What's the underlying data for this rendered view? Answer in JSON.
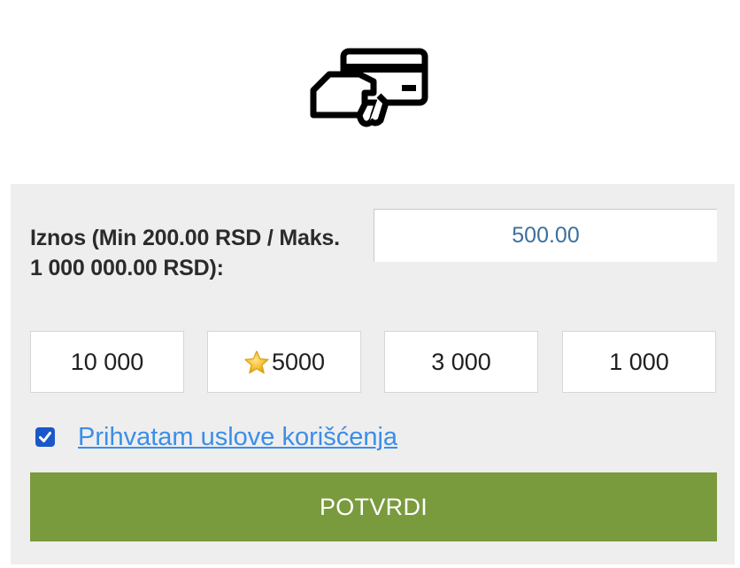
{
  "payment_icon": "card-in-hand-icon",
  "amount": {
    "label": "Iznos (Min 200.00 RSD / Maks. 1 000 000.00 RSD):",
    "value": "500.00"
  },
  "quick_amounts": [
    {
      "label": "10 000",
      "icon": null
    },
    {
      "label": "5000",
      "icon": "star-icon"
    },
    {
      "label": "3 000",
      "icon": null
    },
    {
      "label": "1 000",
      "icon": null
    }
  ],
  "terms": {
    "checked": true,
    "label": "Prihvatam uslove korišćenja"
  },
  "submit": {
    "label": "POTVRDI"
  },
  "colors": {
    "panel_bg": "#eeeeee",
    "submit_bg": "#7a9a3e",
    "link": "#3b8ee8",
    "checkbox": "#1a58c9",
    "input_text": "#3e6f9c"
  }
}
